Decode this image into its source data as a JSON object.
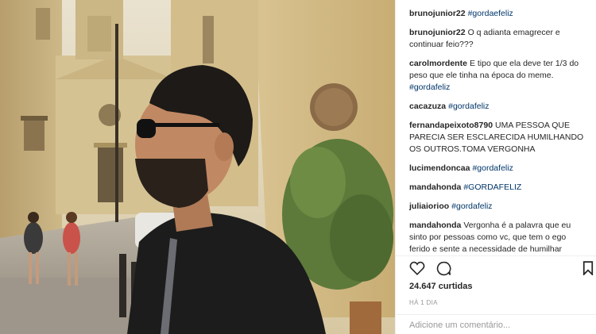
{
  "comments": [
    {
      "user": "brunojunior22",
      "text": "",
      "tag": "#gordaefeliz"
    },
    {
      "user": "brunojunior22",
      "text": "O q adianta emagrecer e continuar feio???",
      "tag": ""
    },
    {
      "user": "carolmordente",
      "text": "E tipo que ela deve ter 1/3 do peso que ele tinha na época do meme.",
      "tag": "#gordafeliz"
    },
    {
      "user": "cacazuza",
      "text": "",
      "tag": "#gordafeliz"
    },
    {
      "user": "fernandapeixoto8790",
      "text": "UMA PESSOA QUE PARECIA SER ESCLARECIDA HUMILHANDO OS OUTROS.TOMA VERGONHA",
      "tag": ""
    },
    {
      "user": "lucimendoncaa",
      "text": "",
      "tag": "#gordafeliz"
    },
    {
      "user": "mandahonda",
      "text": "",
      "tag": "#GORDAFELIZ"
    },
    {
      "user": "juliaiorioo",
      "text": "",
      "tag": "#gordafeliz"
    },
    {
      "user": "mandahonda",
      "text": "Vergonha é a palavra que eu sinto por pessoas como vc, que tem o ego ferido e sente a necessidade de humilhar alguém pra se sentir melhor. Falo o magro de vida infinita, o magrelao felizao, o que",
      "tag": ""
    }
  ],
  "likes": "24.647 curtidas",
  "timestamp": "HÁ 1 DIA",
  "add_comment_placeholder": "Adicione um comentário...",
  "icons": {
    "like": "heart-outline-icon",
    "comment": "speech-bubble-icon",
    "save": "bookmark-icon"
  },
  "colors": {
    "hashtag": "#003569",
    "text": "#262626",
    "muted": "#999999"
  }
}
